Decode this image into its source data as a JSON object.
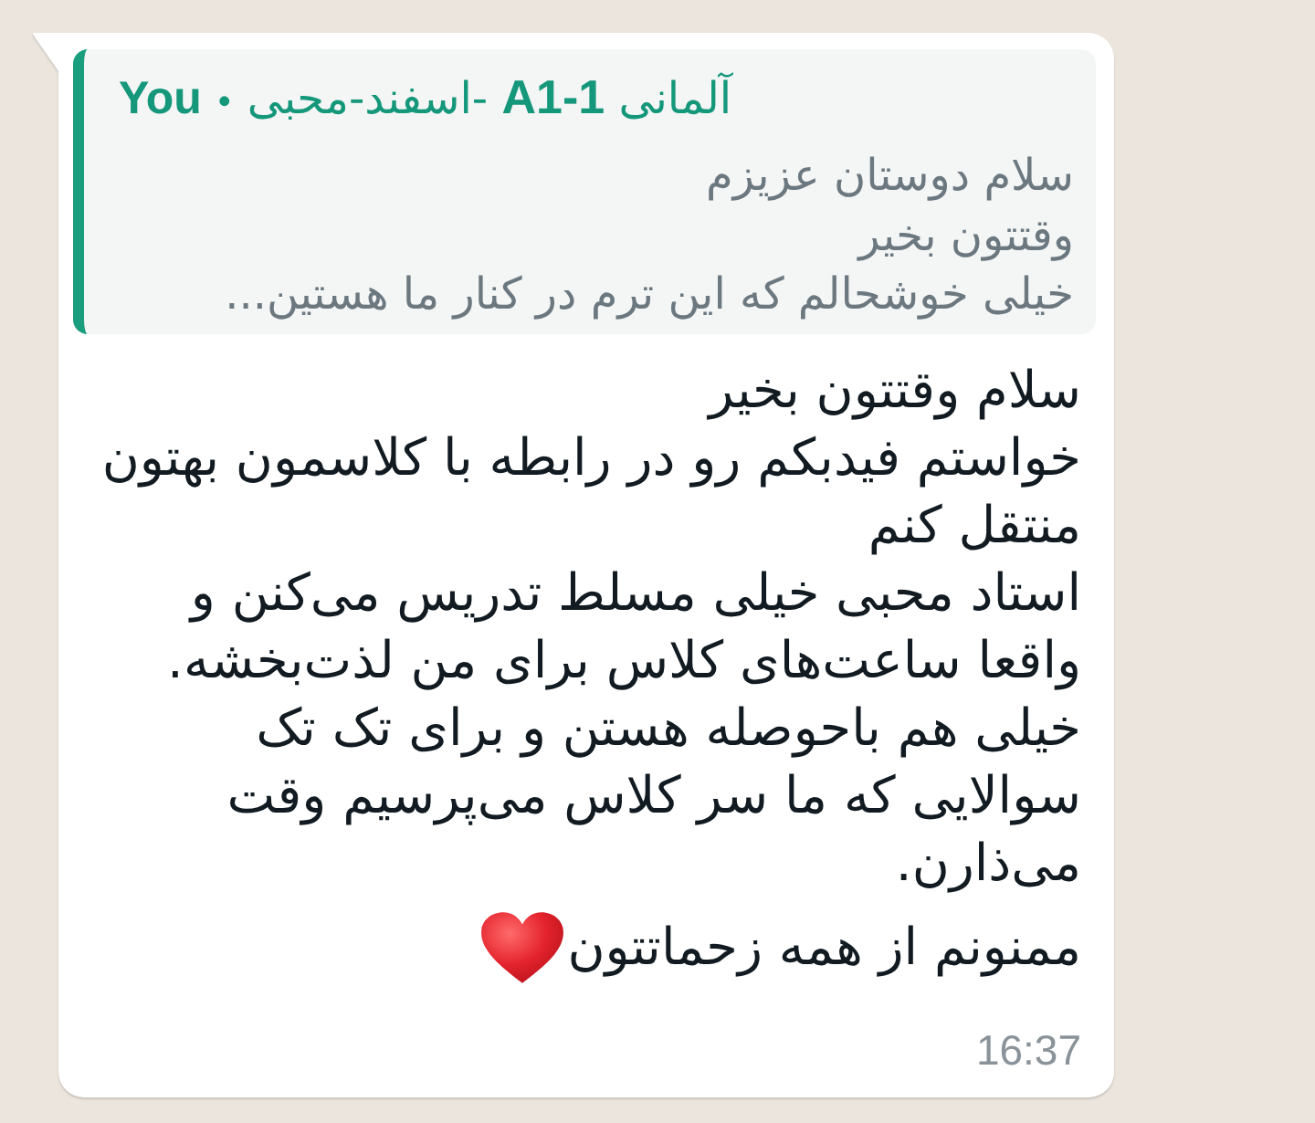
{
  "message": {
    "quote": {
      "sender": "You",
      "separator": "•",
      "group": "آلمانی **A1-1** -اسفند-محبی",
      "text": "سلام دوستان عزیزم\nوقتتون بخیر\nخیلی خوشحالم که این ترم در کنار ما هستین..."
    },
    "text": "سلام وقتتون بخیر\nخواستم فیدبکم رو در رابطه با کلاسمون بهتون\nمنتقل کنم\nاستاد محبی خیلی مسلط تدریس می‌کنن و\nواقعا ساعت‌های کلاس برای من لذت‌بخشه.\nخیلی هم باحوصله هستن و برای تک تک\nسوالایی که ما سر کلاس می‌پرسیم وقت\nمی‌ذارن.",
    "closing": "ممنونم از همه زحماتتون",
    "time": "16:37"
  }
}
